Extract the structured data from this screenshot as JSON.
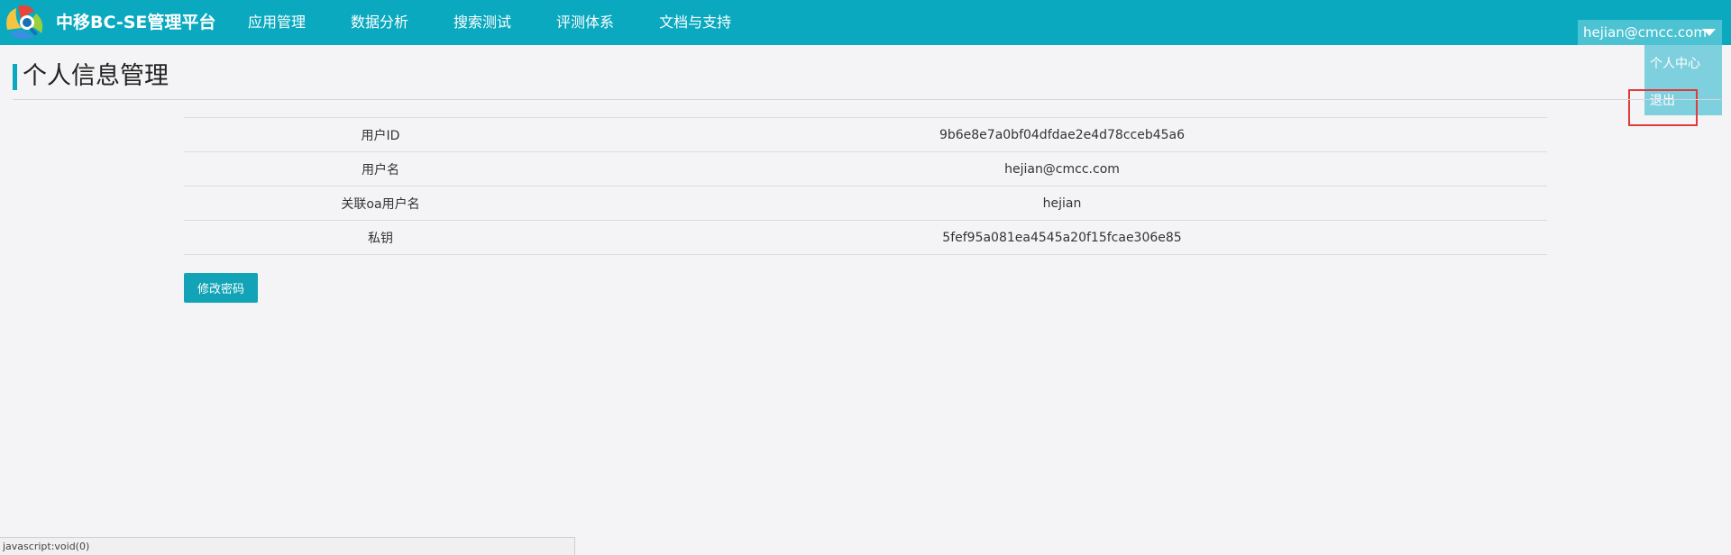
{
  "header": {
    "brand": "中移BC-SE管理平台",
    "nav": [
      {
        "label": "应用管理"
      },
      {
        "label": "数据分析"
      },
      {
        "label": "搜索测试"
      },
      {
        "label": "评测体系"
      },
      {
        "label": "文档与支持"
      }
    ],
    "user": "hejian@cmcc.com",
    "menu": {
      "profile_label": "个人中心",
      "logout_label": "退出"
    },
    "accent_color": "#0aa9bf"
  },
  "page": {
    "title": "个人信息管理"
  },
  "info": {
    "rows": [
      {
        "label": "用户ID",
        "value": "9b6e8e7a0bf04dfdae2e4d78cceb45a6"
      },
      {
        "label": "用户名",
        "value": "hejian@cmcc.com"
      },
      {
        "label": "关联oa用户名",
        "value": "hejian"
      },
      {
        "label": "私钥",
        "value": "5fef95a081ea4545a20f15fcae306e85"
      }
    ]
  },
  "actions": {
    "change_password_label": "修改密码"
  },
  "status": {
    "url": "javascript:void(0)"
  }
}
